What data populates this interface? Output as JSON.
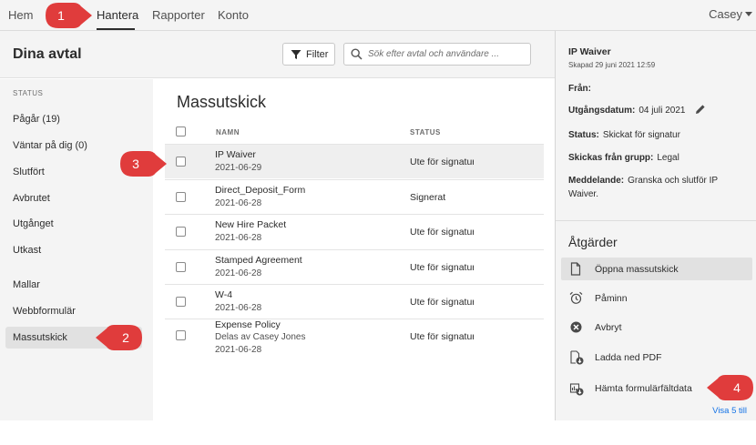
{
  "nav": {
    "items": [
      "Hem",
      "Hantera",
      "Rapporter",
      "Konto"
    ],
    "active": "Hantera",
    "user": "Casey"
  },
  "header": {
    "title": "Dina avtal",
    "filter_label": "Filter",
    "search_placeholder": "Sök efter avtal och användare ..."
  },
  "sidebar": {
    "status_heading": "STATUS",
    "status_items": [
      "Pågår (19)",
      "Väntar på dig (0)",
      "Slutfört",
      "Avbrutet",
      "Utgånget",
      "Utkast"
    ],
    "other_items": [
      "Mallar",
      "Webbformulär",
      "Massutskick"
    ],
    "active": "Massutskick"
  },
  "main": {
    "title": "Massutskick",
    "columns": [
      "NAMN",
      "STATUS"
    ],
    "rows": [
      {
        "name": "IP Waiver",
        "sub": "",
        "date": "2021-06-29",
        "status": "Ute för signatur",
        "selected": true
      },
      {
        "name": "Direct_Deposit_Form",
        "sub": "",
        "date": "2021-06-28",
        "status": "Signerat",
        "selected": false
      },
      {
        "name": "New Hire Packet",
        "sub": "",
        "date": "2021-06-28",
        "status": "Ute för signatur",
        "selected": false
      },
      {
        "name": "Stamped Agreement",
        "sub": "",
        "date": "2021-06-28",
        "status": "Ute för signatur",
        "selected": false
      },
      {
        "name": "W-4",
        "sub": "",
        "date": "2021-06-28",
        "status": "Ute för signatur",
        "selected": false
      },
      {
        "name": "Expense Policy",
        "sub": "Delas av Casey Jones",
        "date": "2021-06-28",
        "status": "Ute för signatur",
        "selected": false
      }
    ]
  },
  "details": {
    "title": "IP Waiver",
    "created": "Skapad 29 juni 2021 12:59",
    "from_label": "Från:",
    "from_value": "",
    "expiry_label": "Utgångsdatum:",
    "expiry_value": "04 juli 2021",
    "status_label": "Status:",
    "status_value": "Skickat för signatur",
    "group_label": "Skickas från grupp:",
    "group_value": "Legal",
    "message_label": "Meddelande:",
    "message_value": "Granska och slutför IP Waiver."
  },
  "actions": {
    "title": "Åtgärder",
    "items": [
      {
        "label": "Öppna massutskick",
        "icon": "document-icon"
      },
      {
        "label": "Påminn",
        "icon": "alarm-clock-icon"
      },
      {
        "label": "Avbryt",
        "icon": "cancel-circle-icon"
      },
      {
        "label": "Ladda ned PDF",
        "icon": "download-pdf-icon"
      },
      {
        "label": "Hämta formulärfältdata",
        "icon": "form-data-icon"
      }
    ],
    "show_more": "Visa 5 till"
  },
  "callouts": [
    "1",
    "2",
    "3",
    "4"
  ],
  "colors": {
    "callout_red": "#e03c3c",
    "link_blue": "#1473e6",
    "panel_gray": "#f4f4f4",
    "highlight_gray": "#e1e1e1"
  }
}
